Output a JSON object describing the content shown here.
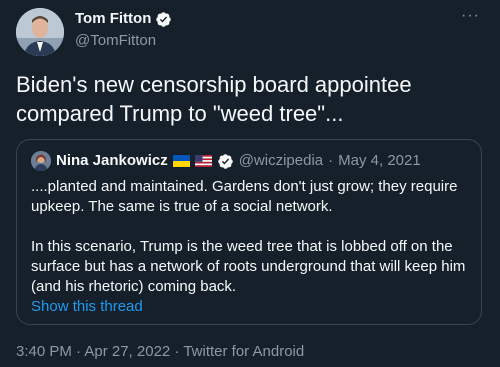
{
  "author": {
    "name": "Tom Fitton",
    "handle": "@TomFitton"
  },
  "more_icon": "···",
  "tweet_text": "Biden's new censorship board appointee compared Trump to \"weed tree\"...",
  "quote": {
    "author_name": "Nina Jankowicz",
    "flags": [
      "flag-ukraine-icon",
      "flag-usa-icon"
    ],
    "handle": "@wiczipedia",
    "separator": "·",
    "date": "May 4, 2021",
    "paragraph1": "....planted and maintained. Gardens don't just grow; they require upkeep. The same is true of a social network.",
    "paragraph2": "In this scenario, Trump is the weed tree that is lobbed off on the surface but has a network of roots underground that will keep him (and his rhetoric) coming back.",
    "show_thread": "Show this thread"
  },
  "footer": "3:40 PM · Apr 27, 2022 · Twitter for Android",
  "colors": {
    "background": "#15202b",
    "text": "#f7f9f9",
    "secondary": "#8b98a5",
    "link": "#1d9bf0",
    "border": "#38444d"
  }
}
